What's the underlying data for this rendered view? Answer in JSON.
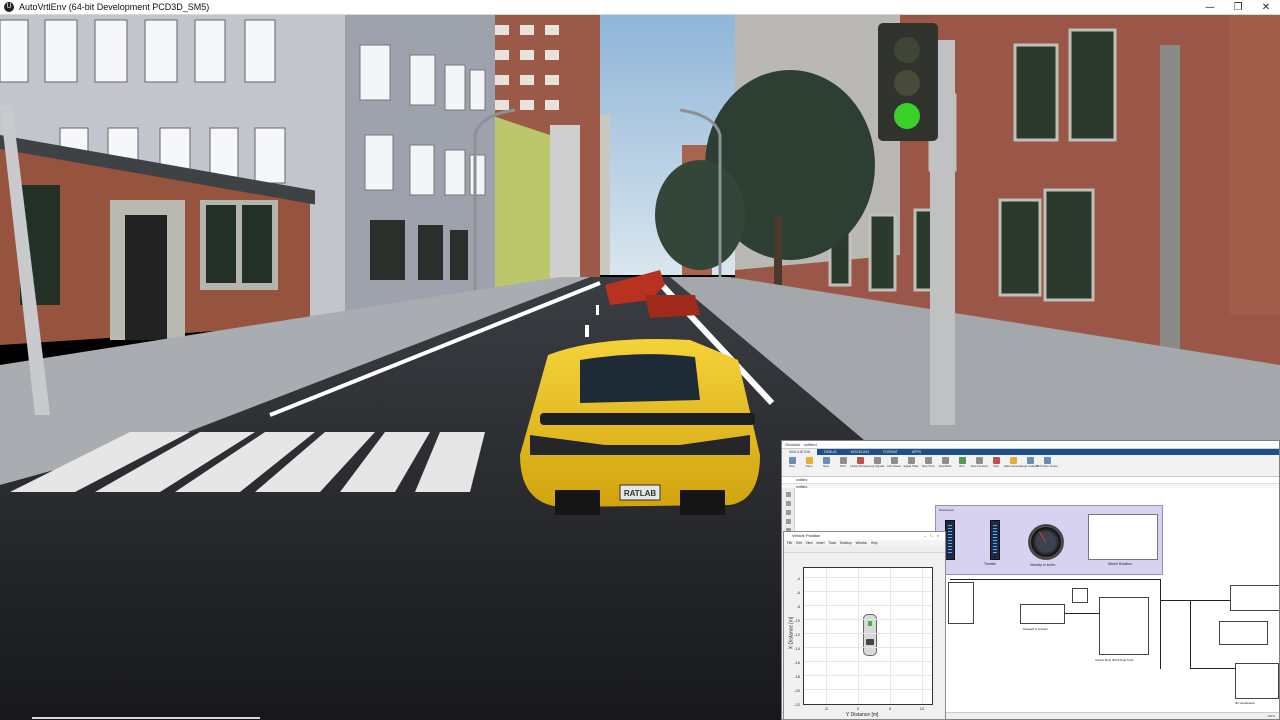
{
  "window": {
    "title": "AutoVrtlEnv (64-bit Development PCD3D_SM5)",
    "app_icon": "unreal-engine-icon",
    "minimize_label": "—",
    "restore_label": "❐",
    "close_label": "✕"
  },
  "scene": {
    "license_plate": "RATLAB",
    "traffic_light_state": "green"
  },
  "simulink": {
    "window_title": "Simulink - untitled",
    "tabs": [
      "SIMULATION",
      "DEBUG",
      "MODELING",
      "FORMAT",
      "APPS"
    ],
    "toolbar_buttons": [
      "New",
      "Open",
      "Save",
      "Print",
      "Library Browser",
      "Log Signals",
      "Add Viewer",
      "Signal Table",
      "Stop Time",
      "Step Back",
      "Run",
      "Step Forward",
      "Stop",
      "Data Inspector",
      "Logic Analyzer",
      "Bird's-Eye Scope"
    ],
    "model_path": "untitled",
    "dashboard": {
      "title": "Dashboard",
      "throttle_label": "Throttle",
      "velocity_label": "Velocity in km/hr",
      "plot_label": "Wheel Rotation"
    },
    "blocks": [
      "Longitudinal Driver",
      "Datapath & Actuator",
      "Vehicle Body 3DOF Dual Track",
      "3D Visualization"
    ],
    "status_left": "Ready",
    "status_right": "100%"
  },
  "figure": {
    "title": "Vehicle Position",
    "menu": [
      "File",
      "Edit",
      "View",
      "Insert",
      "Tools",
      "Desktop",
      "Window",
      "Help"
    ],
    "xlabel": "Y Distance [m]",
    "ylabel": "X Distance [m]",
    "yticks": [
      "-4",
      "-6",
      "-8",
      "-10",
      "-12",
      "-14",
      "-16",
      "-18",
      "-20",
      "-22"
    ],
    "xticks": [
      "-5",
      "0",
      "5",
      "10"
    ]
  },
  "chart_data": {
    "type": "scatter",
    "title": "",
    "xlabel": "Y Distance [m]",
    "ylabel": "X Distance [m]",
    "xlim": [
      -10,
      12
    ],
    "ylim": [
      -22,
      -2
    ],
    "series": [
      {
        "x": [
          0
        ],
        "y": [
          -10
        ]
      }
    ]
  }
}
